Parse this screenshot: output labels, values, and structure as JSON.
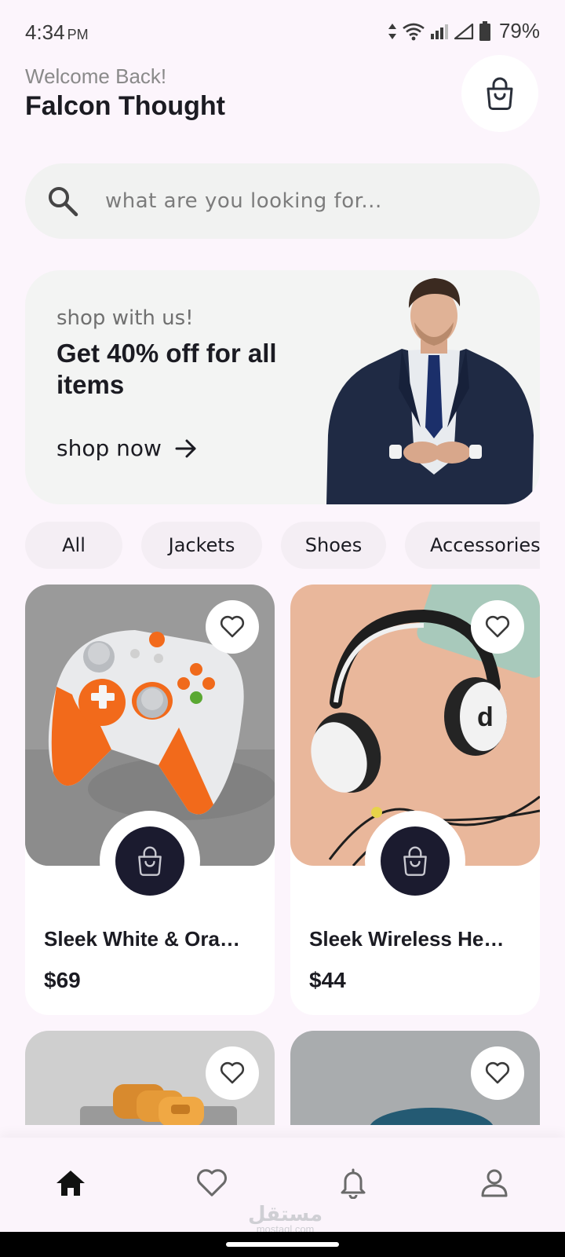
{
  "status_bar": {
    "time": "4:34",
    "ampm": "PM",
    "battery": "79%"
  },
  "header": {
    "welcome": "Welcome Back!",
    "user_name": "Falcon Thought"
  },
  "search": {
    "placeholder": "what are you looking for..."
  },
  "promo": {
    "tag": "shop with us!",
    "headline": "Get 40% off for all items",
    "cta": "shop now"
  },
  "categories": [
    "All",
    "Jackets",
    "Shoes",
    "Accessories"
  ],
  "products": [
    {
      "title": "Sleek White & Ora…",
      "price": "$69"
    },
    {
      "title": "Sleek Wireless He…",
      "price": "$44"
    }
  ],
  "watermark": {
    "arabic": "مستقل",
    "latin": "mostaql.com"
  },
  "colors": {
    "background": "#fcf5fc",
    "accent_dark": "#1b1b2f",
    "card": "#ffffff",
    "chip": "#f4eef4"
  },
  "icons": {
    "top_right": "shopping-bag-icon",
    "search": "search-icon",
    "favorite": "heart-icon",
    "add_to_cart": "shopping-bag-icon",
    "nav": [
      "home-icon",
      "heart-icon",
      "bell-icon",
      "user-icon"
    ]
  }
}
